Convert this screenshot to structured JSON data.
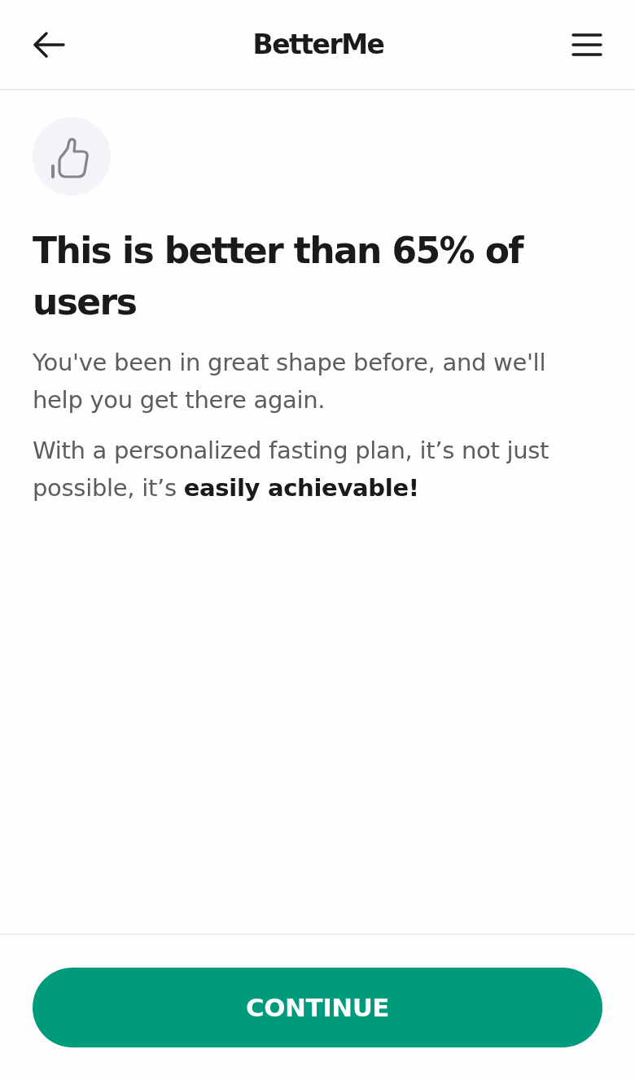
{
  "header": {
    "logo": "BetterMe"
  },
  "content": {
    "title": "This is better than 65% of users",
    "paragraphs": [
      "You've been in great shape before, and we'll help you get there again.",
      "With a personalized fasting plan, it’s not just possible, it’s **easily achievable!**"
    ]
  },
  "footer": {
    "button": "CONTINUE"
  }
}
